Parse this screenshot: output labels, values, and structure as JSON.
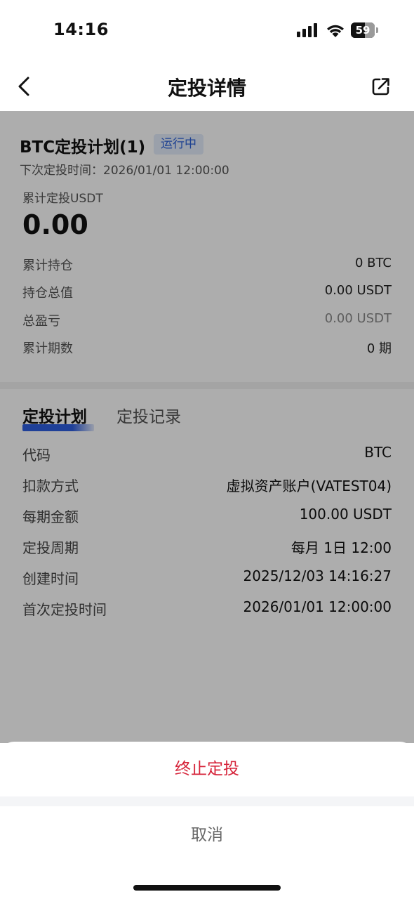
{
  "status_bar": {
    "time": "14:16",
    "battery_level": "59",
    "icons": [
      "cellular-signal-icon",
      "wifi-icon",
      "battery-icon"
    ]
  },
  "nav": {
    "title": "定投详情",
    "back_icon": "chevron-left-icon",
    "share_icon": "share-icon"
  },
  "plan": {
    "title": "BTC定投计划(1)",
    "status_badge": "运行中",
    "next_time": "下次定投时间：2026/01/01 12:00:00",
    "accum_label": "累计定投USDT",
    "accum_value": "0.00",
    "stats": [
      {
        "label": "累计持仓",
        "value": "0 BTC"
      },
      {
        "label": "持仓总值",
        "value": "0.00 USDT"
      },
      {
        "label": "总盈亏",
        "value": "0.00 USDT"
      },
      {
        "label": "累计期数",
        "value": "0 期"
      }
    ]
  },
  "tabs": [
    {
      "label": "定投计划",
      "active": true
    },
    {
      "label": "定投记录",
      "active": false
    }
  ],
  "details": [
    {
      "label": "代码",
      "value": "BTC"
    },
    {
      "label": "扣款方式",
      "value": "虚拟资产账户(VATEST04)"
    },
    {
      "label": "每期金额",
      "value": "100.00 USDT"
    },
    {
      "label": "定投周期",
      "value": "每月 1日 12:00"
    },
    {
      "label": "创建时间",
      "value": "2025/12/03 14:16:27"
    },
    {
      "label": "首次定投时间",
      "value": "2026/01/01 12:00:00"
    }
  ],
  "action_sheet": {
    "stop_label": "终止定投",
    "cancel_label": "取消"
  },
  "colors": {
    "accent": "#2f5fe0",
    "danger": "#d6243a",
    "badge_bg": "#e3ecfb",
    "badge_text": "#2d62d8"
  }
}
